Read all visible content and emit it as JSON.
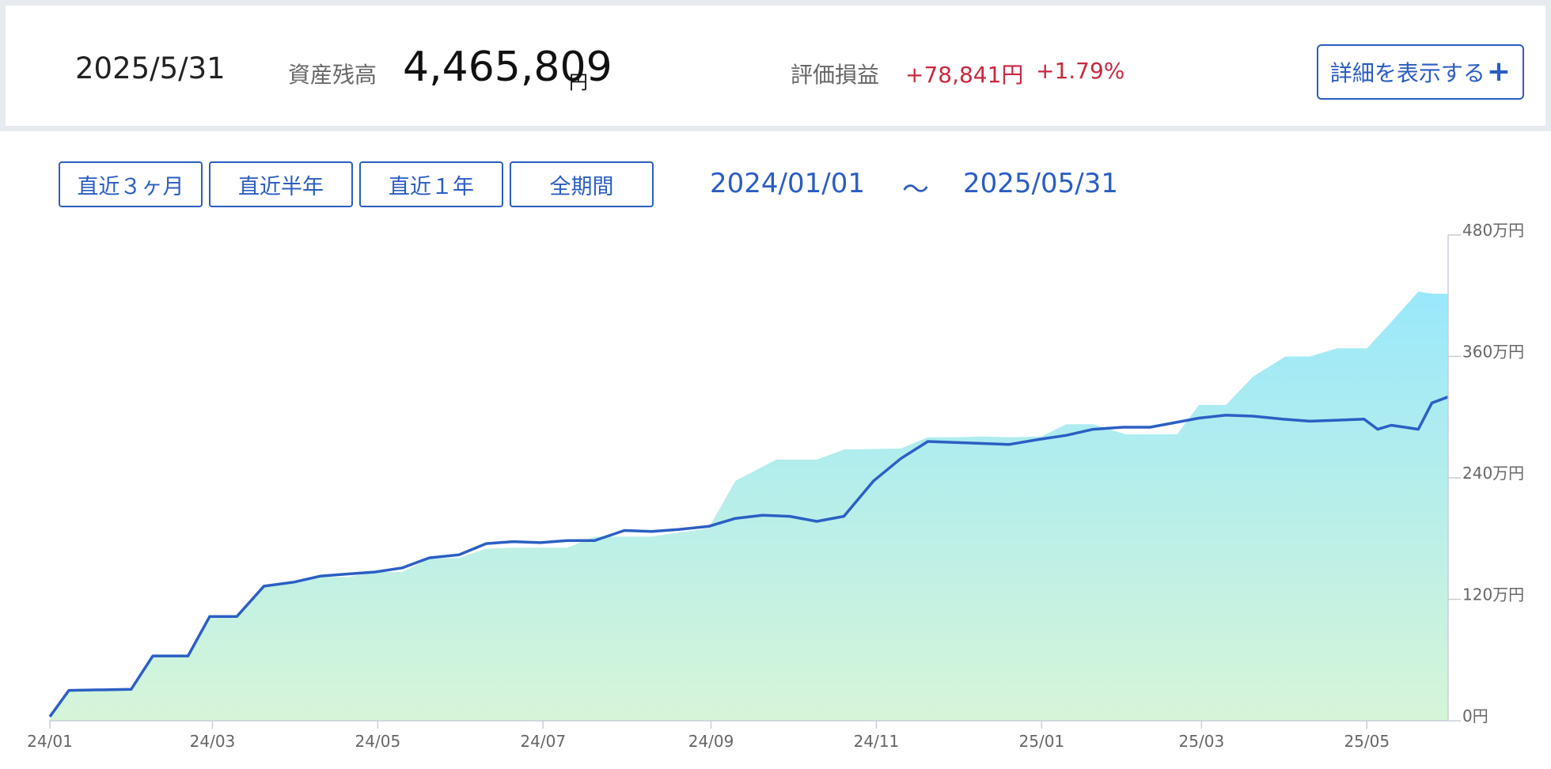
{
  "summary": {
    "date": "2025/5/31",
    "asset_label": "資産残高",
    "asset_value": "4,465,809",
    "asset_unit": "円",
    "pl_label": "評価損益",
    "pl_amount": "+78,841円",
    "pl_rate": "+1.79%",
    "detail_button": "詳細を表示する",
    "detail_icon": "plus-icon"
  },
  "range_buttons": [
    "直近３ヶ月",
    "直近半年",
    "直近１年",
    "全期間"
  ],
  "period": {
    "start": "2024/01/01",
    "separator": "～",
    "end": "2025/05/31"
  },
  "colors": {
    "accent": "#2a5dc1",
    "gain": "#c8283f",
    "line": "#2b5fc4",
    "area_top": "#9ae8fb",
    "area_bottom": "#d6f5d8"
  },
  "chart_data": {
    "type": "area",
    "x_tick_labels": [
      "24/01",
      "24/03",
      "24/05",
      "24/07",
      "24/09",
      "24/11",
      "25/01",
      "25/03",
      "25/05"
    ],
    "y_tick_labels": [
      "0円",
      "120万円",
      "240万円",
      "360万円",
      "480万円"
    ],
    "y_ticks": [
      0,
      1200000,
      2400000,
      3600000,
      4800000
    ],
    "ylim": [
      0,
      4800000
    ],
    "xlim": [
      "2024-01-01",
      "2025-05-31"
    ],
    "grid": false,
    "series": [
      {
        "role": "area",
        "points": [
          [
            "2024-01-01",
            40000
          ],
          [
            "2024-01-08",
            300000
          ],
          [
            "2024-01-31",
            310000
          ],
          [
            "2024-02-08",
            640000
          ],
          [
            "2024-02-21",
            640000
          ],
          [
            "2024-02-29",
            1020000
          ],
          [
            "2024-03-10",
            1020000
          ],
          [
            "2024-03-20",
            1330000
          ],
          [
            "2024-03-31",
            1370000
          ],
          [
            "2024-04-10",
            1420000
          ],
          [
            "2024-04-20",
            1420000
          ],
          [
            "2024-04-30",
            1470000
          ],
          [
            "2024-05-10",
            1470000
          ],
          [
            "2024-05-20",
            1600000
          ],
          [
            "2024-05-31",
            1610000
          ],
          [
            "2024-06-10",
            1700000
          ],
          [
            "2024-06-20",
            1710000
          ],
          [
            "2024-07-10",
            1710000
          ],
          [
            "2024-07-20",
            1820000
          ],
          [
            "2024-08-10",
            1820000
          ],
          [
            "2024-08-20",
            1860000
          ],
          [
            "2024-08-31",
            1900000
          ],
          [
            "2024-09-10",
            2370000
          ],
          [
            "2024-09-25",
            2580000
          ],
          [
            "2024-10-10",
            2580000
          ],
          [
            "2024-10-20",
            2680000
          ],
          [
            "2024-11-10",
            2690000
          ],
          [
            "2024-11-20",
            2800000
          ],
          [
            "2024-11-30",
            2800000
          ],
          [
            "2024-12-10",
            2810000
          ],
          [
            "2024-12-20",
            2800000
          ],
          [
            "2025-01-01",
            2810000
          ],
          [
            "2025-01-10",
            2930000
          ],
          [
            "2025-01-20",
            2930000
          ],
          [
            "2025-02-01",
            2830000
          ],
          [
            "2025-02-20",
            2830000
          ],
          [
            "2025-02-28",
            3120000
          ],
          [
            "2025-03-10",
            3120000
          ],
          [
            "2025-03-20",
            3400000
          ],
          [
            "2025-04-01",
            3600000
          ],
          [
            "2025-04-10",
            3600000
          ],
          [
            "2025-04-20",
            3680000
          ],
          [
            "2025-05-01",
            3680000
          ],
          [
            "2025-05-10",
            3940000
          ],
          [
            "2025-05-20",
            4240000
          ],
          [
            "2025-05-25",
            4220000
          ],
          [
            "2025-05-31",
            4220000
          ]
        ]
      },
      {
        "role": "line",
        "points": [
          [
            "2024-01-01",
            40000
          ],
          [
            "2024-01-08",
            300000
          ],
          [
            "2024-01-31",
            310000
          ],
          [
            "2024-02-08",
            640000
          ],
          [
            "2024-02-21",
            640000
          ],
          [
            "2024-02-29",
            1030000
          ],
          [
            "2024-03-10",
            1030000
          ],
          [
            "2024-03-20",
            1330000
          ],
          [
            "2024-03-31",
            1370000
          ],
          [
            "2024-04-10",
            1430000
          ],
          [
            "2024-04-20",
            1450000
          ],
          [
            "2024-04-30",
            1470000
          ],
          [
            "2024-05-10",
            1510000
          ],
          [
            "2024-05-20",
            1610000
          ],
          [
            "2024-05-31",
            1640000
          ],
          [
            "2024-06-10",
            1750000
          ],
          [
            "2024-06-20",
            1770000
          ],
          [
            "2024-06-30",
            1760000
          ],
          [
            "2024-07-10",
            1780000
          ],
          [
            "2024-07-20",
            1780000
          ],
          [
            "2024-07-31",
            1880000
          ],
          [
            "2024-08-10",
            1870000
          ],
          [
            "2024-08-20",
            1890000
          ],
          [
            "2024-08-31",
            1920000
          ],
          [
            "2024-09-10",
            2000000
          ],
          [
            "2024-09-20",
            2030000
          ],
          [
            "2024-09-30",
            2020000
          ],
          [
            "2024-10-10",
            1970000
          ],
          [
            "2024-10-20",
            2020000
          ],
          [
            "2024-10-31",
            2370000
          ],
          [
            "2024-11-10",
            2590000
          ],
          [
            "2024-11-20",
            2760000
          ],
          [
            "2024-11-30",
            2750000
          ],
          [
            "2024-12-10",
            2740000
          ],
          [
            "2024-12-20",
            2730000
          ],
          [
            "2024-12-31",
            2780000
          ],
          [
            "2025-01-10",
            2820000
          ],
          [
            "2025-01-20",
            2880000
          ],
          [
            "2025-01-31",
            2900000
          ],
          [
            "2025-02-10",
            2900000
          ],
          [
            "2025-02-20",
            2950000
          ],
          [
            "2025-02-28",
            2990000
          ],
          [
            "2025-03-10",
            3020000
          ],
          [
            "2025-03-20",
            3010000
          ],
          [
            "2025-03-31",
            2980000
          ],
          [
            "2025-04-10",
            2960000
          ],
          [
            "2025-04-20",
            2970000
          ],
          [
            "2025-04-30",
            2980000
          ],
          [
            "2025-05-05",
            2880000
          ],
          [
            "2025-05-10",
            2920000
          ],
          [
            "2025-05-15",
            2900000
          ],
          [
            "2025-05-20",
            2880000
          ],
          [
            "2025-05-25",
            3140000
          ],
          [
            "2025-05-31",
            3200000
          ]
        ]
      }
    ]
  }
}
